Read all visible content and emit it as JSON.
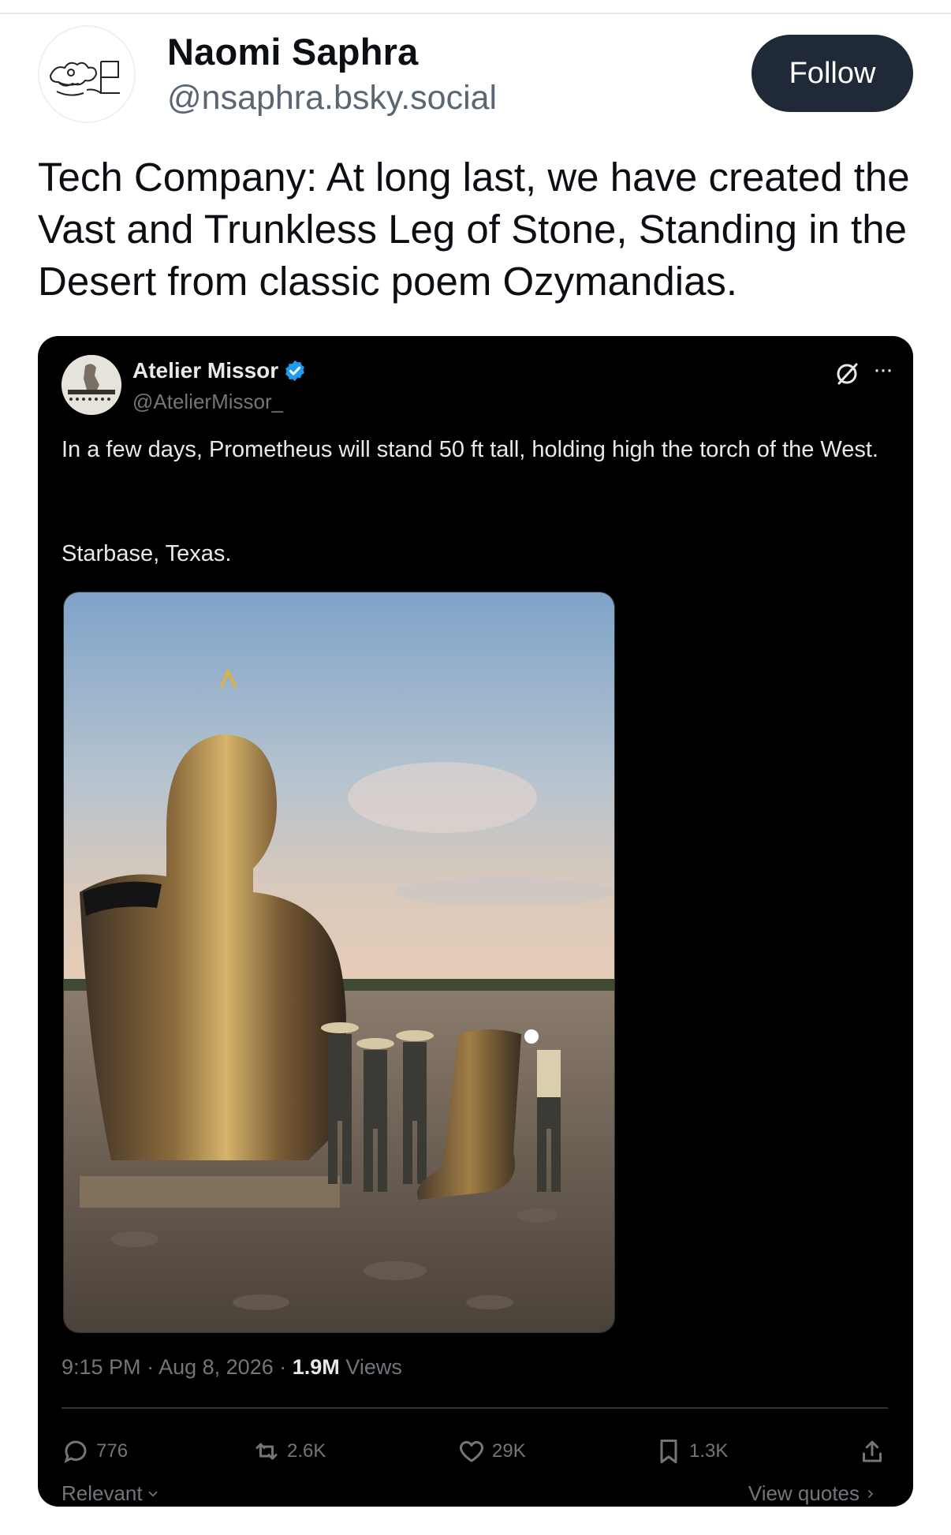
{
  "post": {
    "author": {
      "display_name": "Naomi Saphra",
      "handle": "@nsaphra.bsky.social"
    },
    "follow_label": "Follow",
    "text": "Tech Company: At long last, we have created the Vast and Trunkless Leg of Stone, Standing in the Desert from classic poem Ozymandias."
  },
  "embedded_post": {
    "author": {
      "display_name": "Atelier Missor",
      "handle": "@AtelierMissor_",
      "verified": true
    },
    "text_line1": "In a few days, Prometheus will stand 50 ft tall, holding high the torch of the West.",
    "text_line2": "Starbase, Texas.",
    "meta": {
      "time": "9:15 PM",
      "separator": "·",
      "date": "Aug 8, 2026",
      "views_count": "1.9M",
      "views_label": "Views"
    },
    "actions": {
      "replies": "776",
      "reposts": "2.6K",
      "likes": "29K",
      "bookmarks": "1.3K"
    },
    "footer": {
      "sort_label": "Relevant",
      "quotes_label": "View quotes"
    }
  },
  "colors": {
    "follow_bg": "#1f2937",
    "embed_bg": "#000000",
    "verified": "#1d9bf0",
    "muted": "#71767b"
  }
}
